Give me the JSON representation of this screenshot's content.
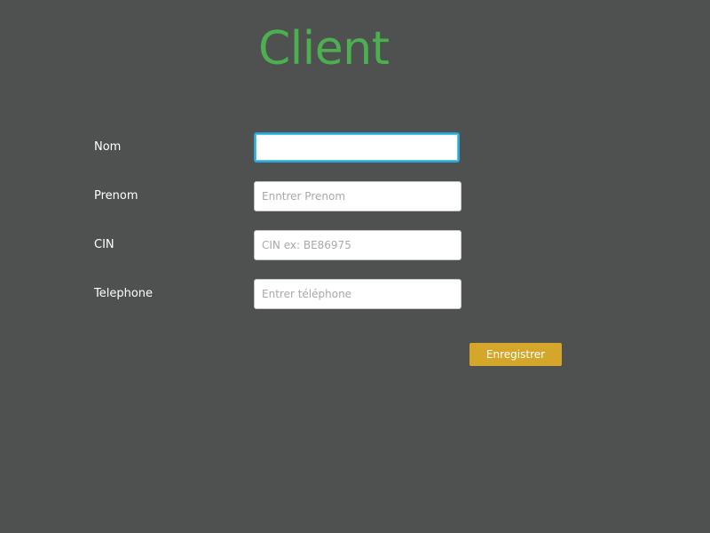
{
  "form": {
    "title": "Client",
    "fields": [
      {
        "label": "Nom",
        "value": "",
        "placeholder": ""
      },
      {
        "label": "Prenom",
        "value": "",
        "placeholder": "Enntrer Prenom"
      },
      {
        "label": "CIN",
        "value": "",
        "placeholder": "CIN ex: BE86975"
      },
      {
        "label": "Telephone",
        "value": "",
        "placeholder": "Entrer téléphone"
      }
    ],
    "submit_label": "Enregistrer"
  },
  "colors": {
    "background": "#4f5050",
    "title": "#4caf50",
    "button": "#d4a62a",
    "focus_border": "#2aa7d6"
  }
}
